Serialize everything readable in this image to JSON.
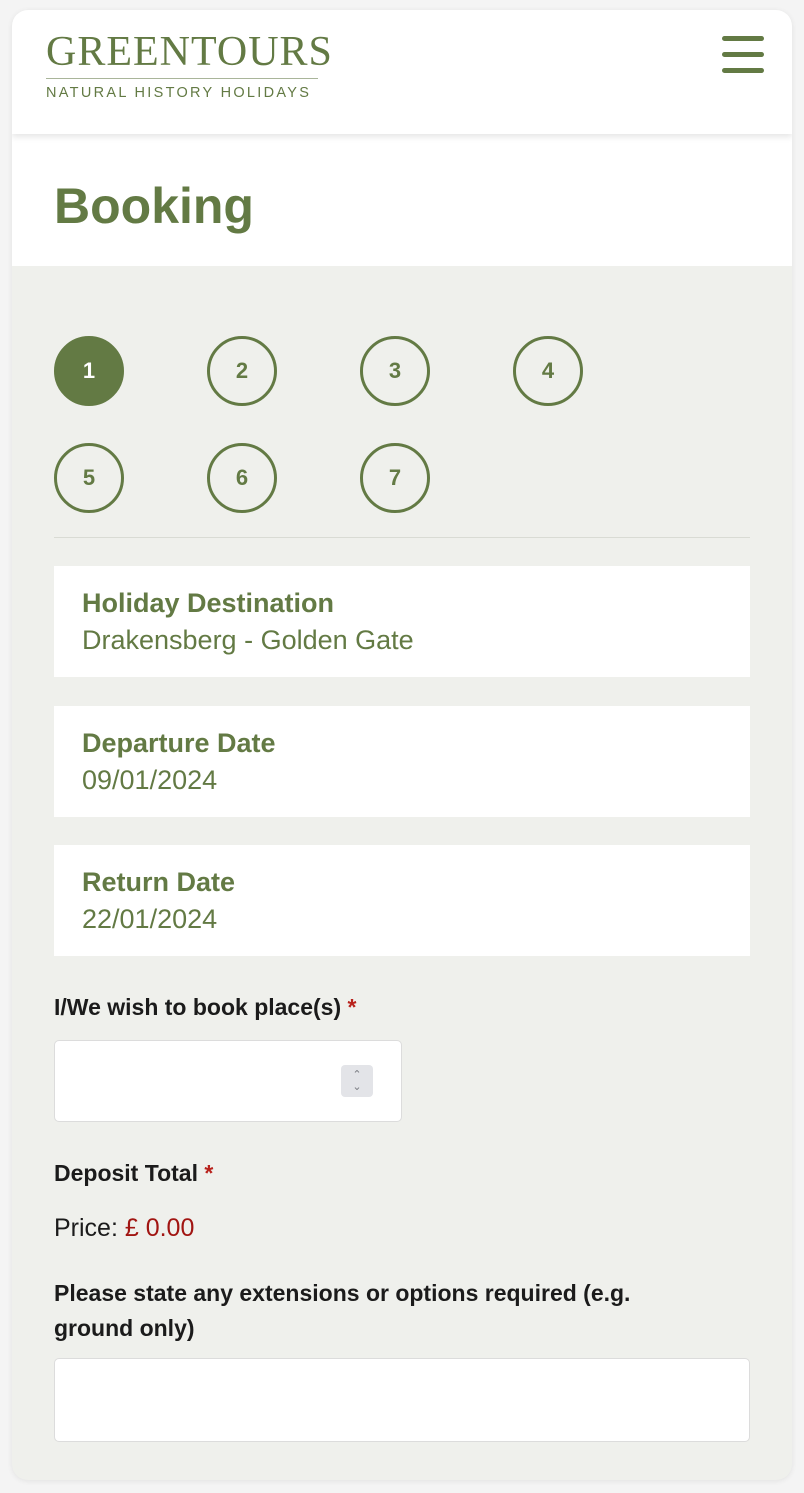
{
  "header": {
    "logo_title": "GREENTOURS",
    "logo_subtitle": "NATURAL HISTORY HOLIDAYS",
    "menu_icon": "hamburger-menu-icon"
  },
  "page": {
    "title": "Booking"
  },
  "steps": [
    {
      "label": "1",
      "active": true
    },
    {
      "label": "2",
      "active": false
    },
    {
      "label": "3",
      "active": false
    },
    {
      "label": "4",
      "active": false
    },
    {
      "label": "5",
      "active": false
    },
    {
      "label": "6",
      "active": false
    },
    {
      "label": "7",
      "active": false
    }
  ],
  "trip": {
    "destination_label": "Holiday Destination",
    "destination_value": "Drakensberg - Golden Gate",
    "departure_label": "Departure Date",
    "departure_value": "09/01/2024",
    "return_label": "Return Date",
    "return_value": "22/01/2024"
  },
  "form": {
    "places_label": "I/We wish to book place(s)",
    "places_value": "",
    "required_marker": "*",
    "deposit_label": "Deposit Total",
    "price_prefix": "Price:",
    "price_value": "£ 0.00",
    "extensions_label": "Please state any extensions or options required (e.g. ground only)",
    "extensions_value": ""
  },
  "colors": {
    "brand_green": "#637a44",
    "page_background": "#eff0ec",
    "required_red": "#b8221c",
    "price_red": "#a11512"
  }
}
